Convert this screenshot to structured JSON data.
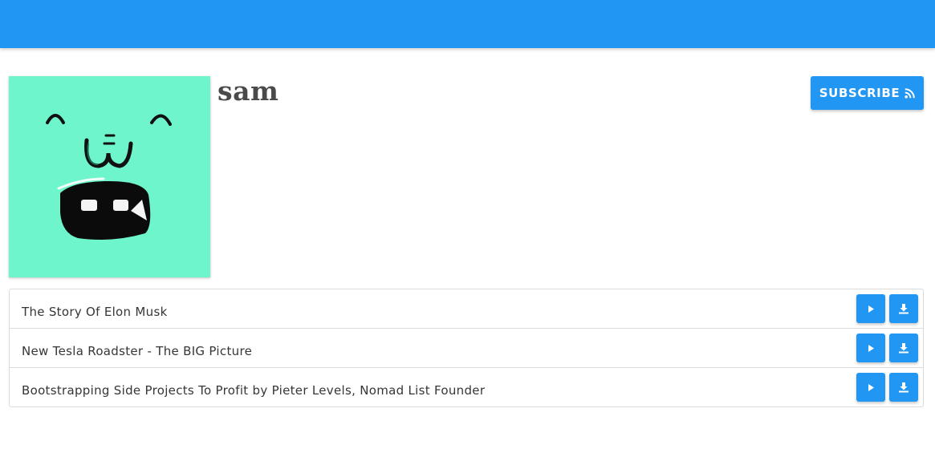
{
  "channel": {
    "name": "sam",
    "subscribe_label": "SUBSCRIBE",
    "subscribe_icon": "rss-icon"
  },
  "colors": {
    "primary": "#2196f3",
    "avatar_bg": "#6ff5cb",
    "text": "#363636"
  },
  "episodes": [
    {
      "title": "The Story Of Elon Musk",
      "play_icon": "play-icon",
      "download_icon": "download-icon"
    },
    {
      "title": "New Tesla Roadster - The BIG Picture",
      "play_icon": "play-icon",
      "download_icon": "download-icon"
    },
    {
      "title": "Bootstrapping Side Projects To Profit by Pieter Levels, Nomad List Founder",
      "play_icon": "play-icon",
      "download_icon": "download-icon"
    }
  ]
}
